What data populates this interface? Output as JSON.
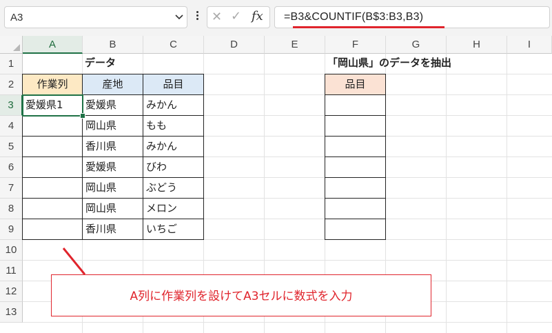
{
  "formula_bar": {
    "name_box": "A3",
    "formula": "=B3&COUNTIF(B$3:B3,B3)",
    "cancel_glyph": "✕",
    "enter_glyph": "✓",
    "fx_label": "fx"
  },
  "columns": [
    "A",
    "B",
    "C",
    "D",
    "E",
    "F",
    "G",
    "H",
    "I"
  ],
  "rows": [
    "1",
    "2",
    "3",
    "4",
    "5",
    "6",
    "7",
    "8",
    "9",
    "10",
    "11",
    "12",
    "13"
  ],
  "title_left": "データ",
  "title_right": "「岡山県」のデータを抽出",
  "headers": {
    "a": "作業列",
    "b": "産地",
    "c": "品目",
    "f": "品目"
  },
  "table": [
    {
      "a": "愛媛県1",
      "b": "愛媛県",
      "c": "みかん"
    },
    {
      "a": "",
      "b": "岡山県",
      "c": "もも"
    },
    {
      "a": "",
      "b": "香川県",
      "c": "みかん"
    },
    {
      "a": "",
      "b": "愛媛県",
      "c": "びわ"
    },
    {
      "a": "",
      "b": "岡山県",
      "c": "ぶどう"
    },
    {
      "a": "",
      "b": "岡山県",
      "c": "メロン"
    },
    {
      "a": "",
      "b": "香川県",
      "c": "いちご"
    }
  ],
  "callout": "A列に作業列を設けてA3セルに数式を入力",
  "colors": {
    "accent_red": "#e0242c",
    "select_green": "#1e7145",
    "hdr_orange": "#fde9c4",
    "hdr_blue": "#dce9f6",
    "hdr_peach": "#fbe2d4"
  }
}
